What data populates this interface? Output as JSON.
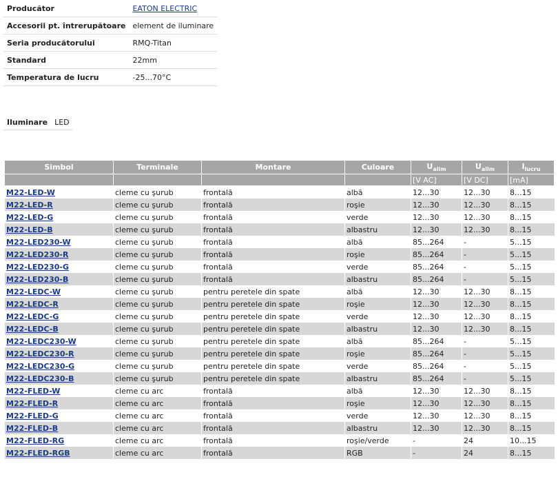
{
  "properties": [
    {
      "label": "Producător",
      "value": "EATON ELECTRIC",
      "link": true
    },
    {
      "label": "Accesorii pt. întrerupătoare",
      "value": "element de iluminare"
    },
    {
      "label": "Seria producătorului",
      "value": "RMQ-Titan"
    },
    {
      "label": "Standard",
      "value": "22mm"
    },
    {
      "label": "Temperatura de lucru",
      "value": "-25...70°C"
    }
  ],
  "illumination": {
    "label": "Iluminare",
    "value": "LED"
  },
  "table": {
    "headers": {
      "simbol": "Simbol",
      "terminale": "Terminale",
      "montare": "Montare",
      "culoare": "Culoare",
      "ualim_ac_main": "U",
      "ualim_ac_sub": "alim",
      "ualim_dc_main": "U",
      "ualim_dc_sub": "alim",
      "ilucru_main": "I",
      "ilucru_sub": "lucru"
    },
    "units": {
      "ac": "[V AC]",
      "dc": "[V DC]",
      "ma": "[mA]"
    },
    "rows": [
      [
        "M22-LED-W",
        "cleme cu şurub",
        "frontală",
        "albă",
        "12...30",
        "12...30",
        "8...15"
      ],
      [
        "M22-LED-R",
        "cleme cu şurub",
        "frontală",
        "roşie",
        "12...30",
        "12...30",
        "8...15"
      ],
      [
        "M22-LED-G",
        "cleme cu şurub",
        "frontală",
        "verde",
        "12...30",
        "12...30",
        "8...15"
      ],
      [
        "M22-LED-B",
        "cleme cu şurub",
        "frontală",
        "albastru",
        "12...30",
        "12...30",
        "8...15"
      ],
      [
        "M22-LED230-W",
        "cleme cu şurub",
        "frontală",
        "albă",
        "85...264",
        "-",
        "5...15"
      ],
      [
        "M22-LED230-R",
        "cleme cu şurub",
        "frontală",
        "roşie",
        "85...264",
        "-",
        "5...15"
      ],
      [
        "M22-LED230-G",
        "cleme cu şurub",
        "frontală",
        "verde",
        "85...264",
        "-",
        "5...15"
      ],
      [
        "M22-LED230-B",
        "cleme cu şurub",
        "frontală",
        "albastru",
        "85...264",
        "-",
        "5...15"
      ],
      [
        "M22-LEDC-W",
        "cleme cu şurub",
        "pentru peretele din spate",
        "albă",
        "12...30",
        "12...30",
        "8...15"
      ],
      [
        "M22-LEDC-R",
        "cleme cu şurub",
        "pentru peretele din spate",
        "roşie",
        "12...30",
        "12...30",
        "8...15"
      ],
      [
        "M22-LEDC-G",
        "cleme cu şurub",
        "pentru peretele din spate",
        "verde",
        "12...30",
        "12...30",
        "8...15"
      ],
      [
        "M22-LEDC-B",
        "cleme cu şurub",
        "pentru peretele din spate",
        "albastru",
        "12...30",
        "12...30",
        "8...15"
      ],
      [
        "M22-LEDC230-W",
        "cleme cu şurub",
        "pentru peretele din spate",
        "albă",
        "85...264",
        "-",
        "5...15"
      ],
      [
        "M22-LEDC230-R",
        "cleme cu şurub",
        "pentru peretele din spate",
        "roşie",
        "85...264",
        "-",
        "5...15"
      ],
      [
        "M22-LEDC230-G",
        "cleme cu şurub",
        "pentru peretele din spate",
        "verde",
        "85...264",
        "-",
        "5...15"
      ],
      [
        "M22-LEDC230-B",
        "cleme cu şurub",
        "pentru peretele din spate",
        "albastru",
        "85...264",
        "-",
        "5...15"
      ],
      [
        "M22-FLED-W",
        "cleme cu arc",
        "frontală",
        "albă",
        "12...30",
        "12...30",
        "8...15"
      ],
      [
        "M22-FLED-R",
        "cleme cu arc",
        "frontală",
        "roşie",
        "12...30",
        "12...30",
        "8...15"
      ],
      [
        "M22-FLED-G",
        "cleme cu arc",
        "frontală",
        "verde",
        "12...30",
        "12...30",
        "8...15"
      ],
      [
        "M22-FLED-B",
        "cleme cu arc",
        "frontală",
        "albastru",
        "12...30",
        "12...30",
        "8...15"
      ],
      [
        "M22-FLED-RG",
        "cleme cu arc",
        "frontală",
        "roşie/verde",
        "-",
        "24",
        "10...15"
      ],
      [
        "M22-FLED-RGB",
        "cleme cu arc",
        "frontală",
        "RGB",
        "-",
        "24",
        "8...15"
      ]
    ]
  }
}
